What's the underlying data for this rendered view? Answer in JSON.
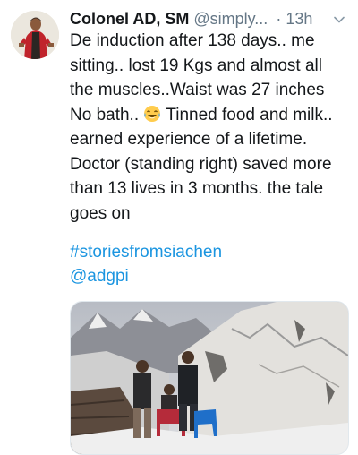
{
  "tweet": {
    "display_name": "Colonel AD, SM",
    "handle": "@simply...",
    "separator": "·",
    "time": "13h",
    "menu_icon": "chevron-down-icon",
    "text_lines": [
      "De induction after 138 days.. me",
      "sitting.. lost 19 Kgs and almost all",
      "the muscles..Waist was 27 inches",
      "No bath..",
      "Tinned food and milk..",
      "earned experience of a lifetime.",
      "Doctor (standing right) saved more",
      "than 13 lives in 3 months. the tale",
      "goes on"
    ],
    "emoji": "face-with-tears-of-joy",
    "hashtag": "#storiesfromsiachen",
    "mention": "@adgpi"
  },
  "colors": {
    "text": "#14171a",
    "secondary": "#657786",
    "link": "#1b95e0"
  }
}
